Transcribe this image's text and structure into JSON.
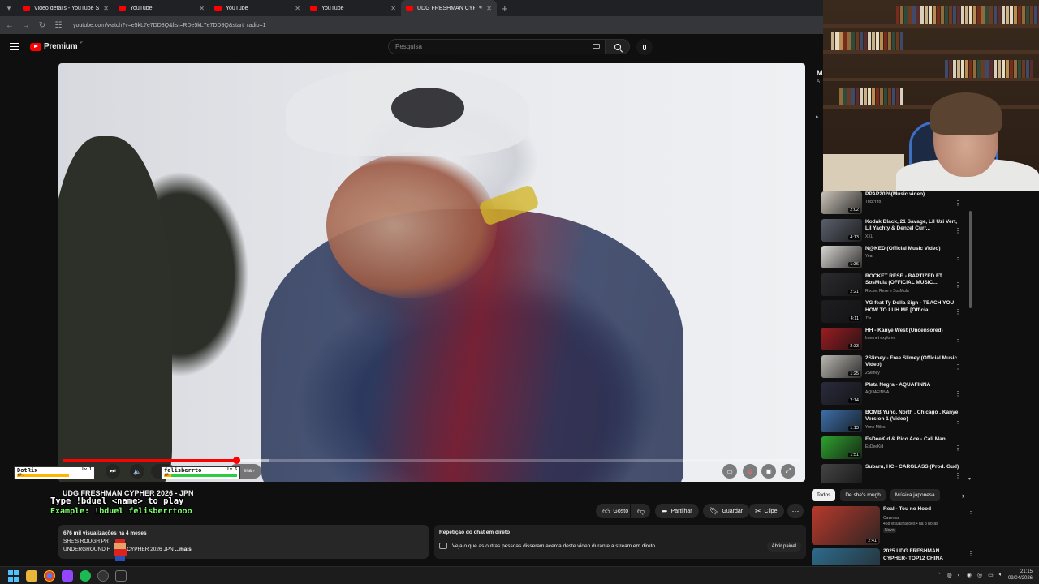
{
  "browser": {
    "tabs": [
      {
        "title": "Video details - YouTube Studio",
        "active": false
      },
      {
        "title": "YouTube",
        "active": false
      },
      {
        "title": "YouTube",
        "active": false
      },
      {
        "title": "YouTube",
        "active": false
      },
      {
        "title": "UDG FRESHMAN CYPHER 2",
        "active": true
      }
    ],
    "url": "youtube.com/watch?v=e5kL7e7DD8Q&list=RDe5kL7e7DD8Q&start_radio=1"
  },
  "header": {
    "logo_text": "Premium",
    "logo_sup": "PT",
    "search_placeholder": "Pesquisa"
  },
  "player": {
    "progress_fraction": 0.235,
    "buffer_fraction": 0.28,
    "chapter_hint": "ena"
  },
  "overlay": {
    "player1": {
      "name": "DotRix",
      "level": "Lv.1",
      "hp_label": "HP:"
    },
    "player2": {
      "name": "felisberrto",
      "level": "Lv.6",
      "hp_label": "HP:"
    },
    "line1": "Type !bduel <name> to play",
    "line2": "Example: !bduel felisberrtooo"
  },
  "video": {
    "title": "UDG FRESHMAN CYPHER 2026 - JPN",
    "actions": {
      "like": "Gosto",
      "share": "Partilhar",
      "save": "Guardar",
      "clip": "Clipe"
    },
    "description": {
      "meta": "676 mil visualizações  há 4 meses",
      "line1": "SHE'S ROUGH PR",
      "line2_a": "UNDERGROUND F",
      "line2_b": "N CYPHER 2026 JPN",
      "more": "...mais"
    }
  },
  "live_chat": {
    "title": "Repetição do chat em direto",
    "text": "Veja o que as outras pessoas disseram acerca deste vídeo durante a stream em direto.",
    "open_button": "Abrir painel"
  },
  "side_edge": {
    "letter": "M",
    "sub": "A"
  },
  "playlist": [
    {
      "title": "PPAP2026(Music video)",
      "channel": "TrickYzo",
      "duration": "2:02",
      "color": "#c9c2b8"
    },
    {
      "title": "Kodak Black, 21 Savage, Lil Uzi Vert, Lil Yachty & Denzel Curr...",
      "channel": "XXL",
      "duration": "4:13",
      "color": "#5a5f6a"
    },
    {
      "title": "N@KED (Official Music Video)",
      "channel": "Yeat",
      "duration": "1:36",
      "color": "#d8d6d2"
    },
    {
      "title": "ROCKET RESE - BAPTIZED FT. SosMula (OFFICIAL MUSIC...",
      "channel": "Rocket Rese e SosMula",
      "duration": "2:21",
      "color": "#2b2b2e"
    },
    {
      "title": "YG feat Ty Dolla Sign - TEACH YOU HOW TO LUH ME [Officia...",
      "channel": "YG",
      "duration": "4:11",
      "color": "#1e1e22"
    },
    {
      "title": "HH - Kanye West (Uncensored)",
      "channel": "Internet explorer",
      "duration": "2:33",
      "color": "#9b1d22"
    },
    {
      "title": "2Slimey - Free Slimey (Official Music Video)",
      "channel": "2Slimey",
      "duration": "1:25",
      "color": "#b9b6b0"
    },
    {
      "title": "Plata Negra - AQUAFINNA",
      "channel": "AQUAFINNA",
      "duration": "2:14",
      "color": "#2a2b3c"
    },
    {
      "title": "BOMB Yuno, North , Chicago , Kanye Version 1 (Video)",
      "channel": "Yuno Miles",
      "duration": "1:13",
      "color": "#3d6fa8"
    },
    {
      "title": "EsDeeKid & Rico Ace - Cali Man",
      "channel": "EsDeeKid",
      "duration": "1:51",
      "color": "#2ea12e"
    },
    {
      "title": "Subaru, HC - CARGLASS (Prod. Gud)",
      "channel": "",
      "duration": "",
      "color": "#444"
    }
  ],
  "chips": [
    "Todos",
    "De she's rough",
    "Música japonesa"
  ],
  "recommended": [
    {
      "title": "Real - Tou no Hood",
      "channel": "Caverna",
      "meta": "458 visualizações • há 3 horas",
      "badge": "Novo",
      "duration": "2:41",
      "color": "#b8392c"
    },
    {
      "title": "2025 UDG FRESHMAN CYPHER- TOP12 CHINA",
      "channel": "",
      "meta": "",
      "badge": "",
      "duration": "",
      "color": "#2e6b8c"
    }
  ],
  "taskbar": {
    "time": "21:15",
    "date": "09/04/2026"
  }
}
